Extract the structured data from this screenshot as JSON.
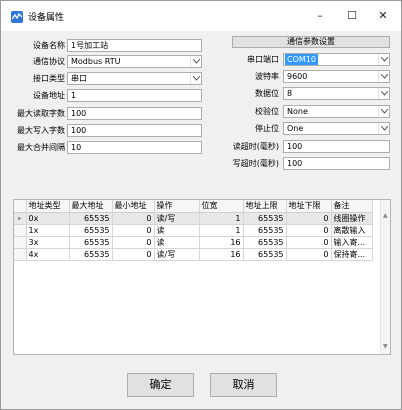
{
  "window": {
    "title": "设备属性",
    "minimize": "–",
    "maximize": "☐",
    "close": "✕"
  },
  "device": {
    "name_label": "设备名称",
    "name_value": "1号加工站",
    "protocol_label": "通信协议",
    "protocol_value": "Modbus RTU",
    "interface_label": "接口类型",
    "interface_value": "串口",
    "address_label": "设备地址",
    "address_value": "1",
    "max_read_label": "最大读取字数",
    "max_read_value": "100",
    "max_write_label": "最大写入字数",
    "max_write_value": "100",
    "max_merge_label": "最大合并间隔",
    "max_merge_value": "10"
  },
  "comm": {
    "settings_button": "通信参数设置",
    "port_label": "串口端口",
    "port_value": "COM10",
    "baud_label": "波特率",
    "baud_value": "9600",
    "databits_label": "数据位",
    "databits_value": "8",
    "parity_label": "校验位",
    "parity_value": "None",
    "stopbits_label": "停止位",
    "stopbits_value": "One",
    "read_timeout_label": "读超时(毫秒)",
    "read_timeout_value": "100",
    "write_timeout_label": "写超时(毫秒)",
    "write_timeout_value": "100"
  },
  "table": {
    "headers": [
      "地址类型",
      "最大地址",
      "最小地址",
      "操作",
      "位宽",
      "地址上限",
      "地址下限",
      "备注"
    ],
    "rows": [
      [
        "0x",
        "65535",
        "0",
        "读/写",
        "1",
        "65535",
        "0",
        "线圈操作"
      ],
      [
        "1x",
        "65535",
        "0",
        "读",
        "1",
        "65535",
        "0",
        "离散输入"
      ],
      [
        "3x",
        "65535",
        "0",
        "读",
        "16",
        "65535",
        "0",
        "输入寄..."
      ],
      [
        "4x",
        "65535",
        "0",
        "读/写",
        "16",
        "65535",
        "0",
        "保持寄..."
      ]
    ],
    "row_indicator": "▸"
  },
  "buttons": {
    "ok": "确定",
    "cancel": "取消"
  }
}
